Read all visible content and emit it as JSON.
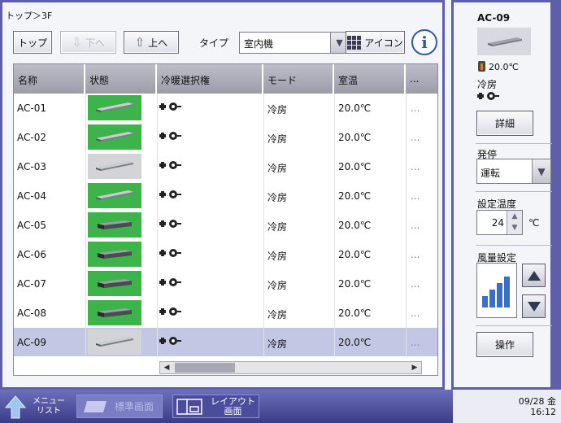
{
  "breadcrumb": "トップ＞3F",
  "toolbar": {
    "top_label": "トップ",
    "down_label": "下へ",
    "up_label": "上へ",
    "type_label": "タイプ",
    "type_value": "室内機",
    "icon_label": "アイコン"
  },
  "table": {
    "headers": [
      "名称",
      "状態",
      "冷暖選択権",
      "モード",
      "室温",
      "..."
    ],
    "rows": [
      {
        "name": "AC-01",
        "state": "on",
        "unit": "ceiling",
        "mode": "冷房",
        "temp": "20.0℃",
        "more": "..."
      },
      {
        "name": "AC-02",
        "state": "on",
        "unit": "ceiling",
        "mode": "冷房",
        "temp": "20.0℃",
        "more": "..."
      },
      {
        "name": "AC-03",
        "state": "off",
        "unit": "ceiling",
        "mode": "冷房",
        "temp": "20.0℃",
        "more": "..."
      },
      {
        "name": "AC-04",
        "state": "on",
        "unit": "ceiling",
        "mode": "冷房",
        "temp": "20.0℃",
        "more": "..."
      },
      {
        "name": "AC-05",
        "state": "on",
        "unit": "duct",
        "mode": "冷房",
        "temp": "20.0℃",
        "more": "..."
      },
      {
        "name": "AC-06",
        "state": "on",
        "unit": "duct",
        "mode": "冷房",
        "temp": "20.0℃",
        "more": "..."
      },
      {
        "name": "AC-07",
        "state": "on",
        "unit": "duct",
        "mode": "冷房",
        "temp": "20.0℃",
        "more": "..."
      },
      {
        "name": "AC-08",
        "state": "on",
        "unit": "duct",
        "mode": "冷房",
        "temp": "20.0℃",
        "more": "..."
      },
      {
        "name": "AC-09",
        "state": "off",
        "unit": "ceiling",
        "mode": "冷房",
        "temp": "20.0℃",
        "more": "..."
      }
    ]
  },
  "side": {
    "unit_name": "AC-09",
    "room_temp": "20.0℃",
    "mode": "冷房",
    "detail_label": "詳細",
    "onoff_label": "発停",
    "onoff_value": "運転",
    "setpoint_label": "設定温度",
    "setpoint_value": "24",
    "setpoint_unit": "℃",
    "fan_label": "風量設定",
    "fan_level": 4,
    "operate_label": "操作"
  },
  "taskbar": {
    "menu_line1": "メニュー",
    "menu_line2": "リスト",
    "standard_label": "標準画面",
    "layout_line1": "レイアウト",
    "layout_line2": "画面",
    "date": "09/28 金",
    "time": "16:12"
  },
  "colors": {
    "frame": "#5e5fa8",
    "state_on": "#3cb44a",
    "state_off": "#d4d4d8",
    "selected_row": "#c3c7e4"
  }
}
